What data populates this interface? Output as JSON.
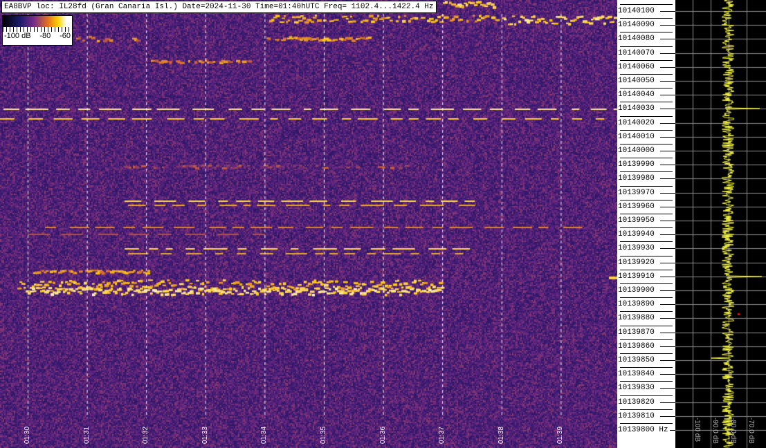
{
  "title": "EA8BVP loc: IL28fd (Gran Canaria Isl.) Date=2024-11-30 Time=01:40hUTC Freq= 1102.4...1422.4 Hz",
  "legend": {
    "labels": [
      "-100 dB",
      "-80",
      "-60"
    ]
  },
  "freq_labels": [
    "10140100",
    "10140090",
    "10140080",
    "10140070",
    "10140060",
    "10140050",
    "10140040",
    "10140030",
    "10140020",
    "10140010",
    "10140000",
    "10139990",
    "10139980",
    "10139970",
    "10139960",
    "10139950",
    "10139940",
    "10139930",
    "10139920",
    "10139910",
    "10139900",
    "10139890",
    "10139880",
    "10139870",
    "10139860",
    "10139850",
    "10139840",
    "10139830",
    "10139820",
    "10139810",
    "10139800 Hz"
  ],
  "time_labels": [
    "01:30",
    "01:31",
    "01:32",
    "01:33",
    "01:34",
    "01:35",
    "01:36",
    "01:37",
    "01:38",
    "01:39"
  ],
  "power_labels": [
    "-100 dB",
    "-90.0 dB",
    "-80.0 dB",
    "-70.0 dB"
  ],
  "colors": {
    "trace": "#ffff40",
    "grid": "#909090"
  }
}
